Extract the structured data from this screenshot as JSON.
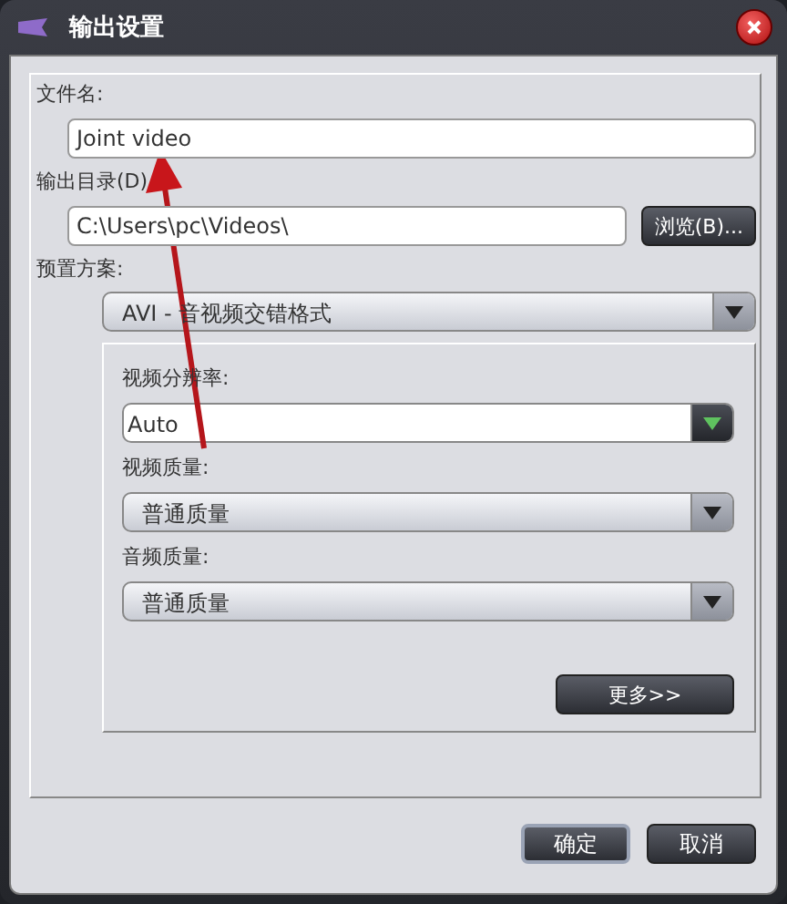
{
  "window": {
    "title": "输出设置"
  },
  "fields": [
    {
      "label": "文件名:",
      "value": "Joint video"
    },
    {
      "label": "输出目录(D)",
      "value": "C:\\Users\\pc\\Videos\\",
      "button": "浏览(B)..."
    }
  ],
  "preset": {
    "label": "预置方案:",
    "value": "AVI - 音视频交错格式"
  },
  "settings": [
    {
      "label": "视频分辨率:",
      "value": "Auto",
      "kind": "combo"
    },
    {
      "label": "视频质量:",
      "value": "普通质量",
      "kind": "select"
    },
    {
      "label": "音频质量:",
      "value": "普通质量",
      "kind": "select"
    }
  ],
  "more_button": "更多>>",
  "buttons": [
    {
      "label": "确定",
      "focused": true
    },
    {
      "label": "取消",
      "focused": false
    }
  ]
}
